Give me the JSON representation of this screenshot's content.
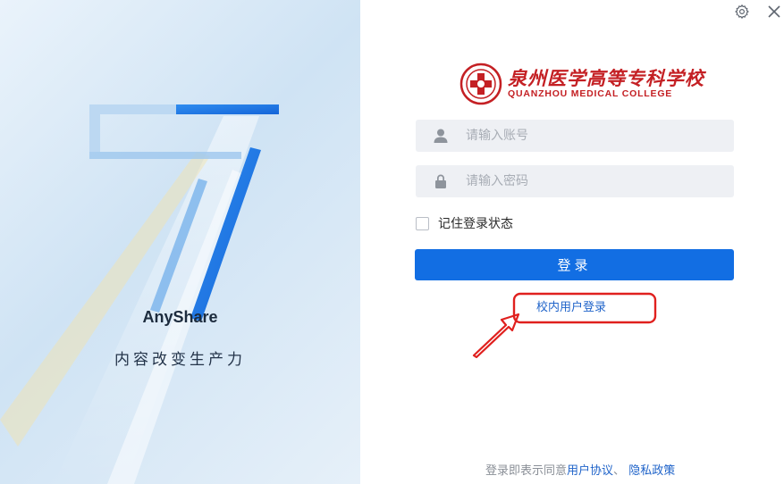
{
  "brand": {
    "name": "AnyShare",
    "slogan": "内容改变生产力"
  },
  "window": {
    "settings_icon": "gear-icon",
    "close_icon": "close-icon"
  },
  "logo": {
    "name_cn": "泉州医学高等专科学校",
    "name_en": "QUANZHOU MEDICAL COLLEGE",
    "color": "#c42024"
  },
  "login": {
    "username_placeholder": "请输入账号",
    "password_placeholder": "请输入密码",
    "remember_label": "记住登录状态",
    "remember_checked": false,
    "submit_label": "登录",
    "campus_login_link": "校内用户登录"
  },
  "footer": {
    "prefix": "登录即表示同意",
    "user_agreement": "用户协议",
    "separator": "、",
    "privacy_policy": "隐私政策"
  },
  "colors": {
    "primary": "#126ee3",
    "link": "#1f63c9",
    "annotation": "#e0201e"
  }
}
